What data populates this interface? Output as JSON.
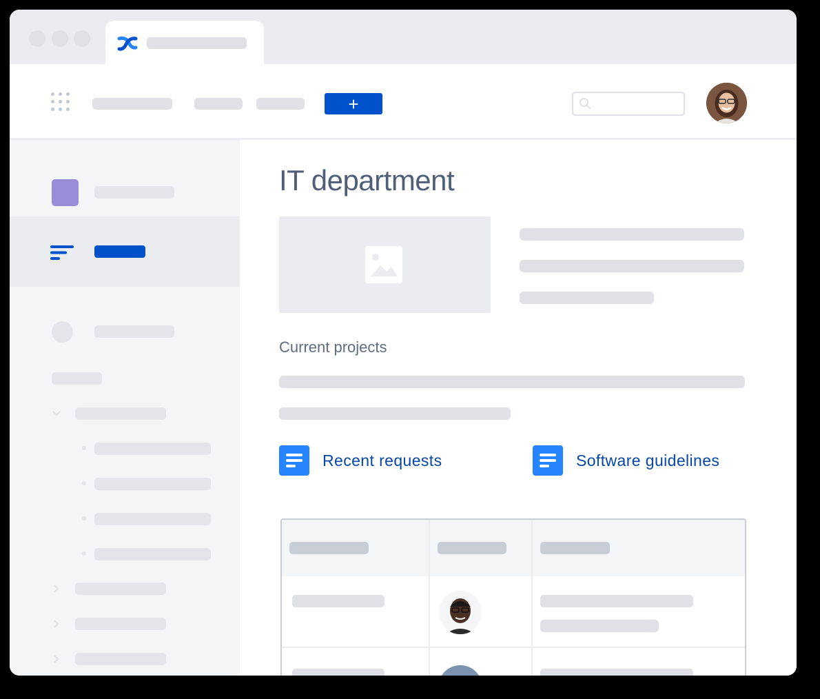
{
  "page": {
    "title": "IT department",
    "section_title": "Current projects"
  },
  "navbar": {
    "create_label": "+"
  },
  "links": [
    {
      "label": "Recent requests"
    },
    {
      "label": "Software guidelines"
    }
  ],
  "colors": {
    "accent": "#0052cc",
    "link": "#0747a6",
    "doc_icon": "#2684ff",
    "space_avatar": "#998dd9"
  },
  "icons": {
    "logo": "confluence-logo-icon",
    "apps": "app-switcher-icon",
    "search": "search-icon",
    "nav_active": "filter-lines-icon",
    "image": "image-placeholder-icon",
    "doc": "page-document-icon"
  }
}
